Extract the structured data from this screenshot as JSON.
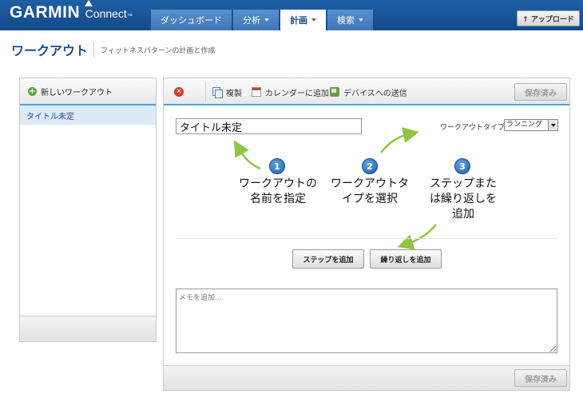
{
  "app": {
    "brand": "GARMIN",
    "sub": "Connect",
    "tm": "™"
  },
  "nav": {
    "tabs": [
      {
        "label": "ダッシュボード"
      },
      {
        "label": "分析"
      },
      {
        "label": "計画"
      },
      {
        "label": "検索"
      }
    ],
    "upload_label": "↑ アップロード"
  },
  "page": {
    "title": "ワークアウト",
    "subtitle": "フィットネスパターンの計画と作成"
  },
  "sidebar": {
    "new_label": "新しいワークアウト",
    "items": [
      {
        "label": "タイトル未定"
      }
    ]
  },
  "toolbar": {
    "copy_label": "複製",
    "calendar_label": "カレンダーに追加",
    "device_label": "デバイスへの送信",
    "save_label": "保存済み"
  },
  "editor": {
    "title_value": "タイトル未定",
    "type_label": "ワークアウトタイプ:",
    "type_value": "ランニング",
    "steps": [
      {
        "num": "1",
        "line1": "ワークアウトの",
        "line2": "名前を指定"
      },
      {
        "num": "2",
        "line1": "ワークアウトタ",
        "line2": "イプを選択"
      },
      {
        "num": "3",
        "line1": "ステップまた",
        "line2": "は繰り返しを",
        "line3": "追加"
      }
    ],
    "add_step_label": "ステップを追加",
    "add_repeat_label": "繰り返しを追加",
    "memo_placeholder": "メモを追加..."
  },
  "colors": {
    "topbar": "#1f5fa6",
    "accent": "#4aa3df",
    "arrow": "#8cc63e"
  }
}
